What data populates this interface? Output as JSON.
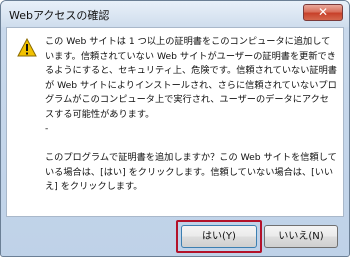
{
  "window": {
    "title": "Webアクセスの確認",
    "close_glyph": "✕"
  },
  "dialog": {
    "icon": "warning-icon",
    "paragraph1": "この Web サイトは 1 つ以上の証明書をこのコンピュータに追加しています。信頼されていない Web サイトがユーザーの証明書を更新できるようにすると、セキュリティ上、危険です。信頼されていない証明書が Web サイトによりインストールされ、さらに信頼されていないプログラムがこのコンピュータ上で実行され、ユーザーのデータにアクセスする可能性があります。",
    "dash": "-",
    "paragraph2": "このプログラムで証明書を追加しますか？この Web サイトを信頼している場合は、[はい] をクリックします。信頼していない場合は、[いいえ] をクリックします。"
  },
  "buttons": {
    "yes_label": "はい(Y)",
    "no_label": "いいえ(N)"
  },
  "colors": {
    "highlight": "#b3122a",
    "warning": "#f2c200"
  }
}
